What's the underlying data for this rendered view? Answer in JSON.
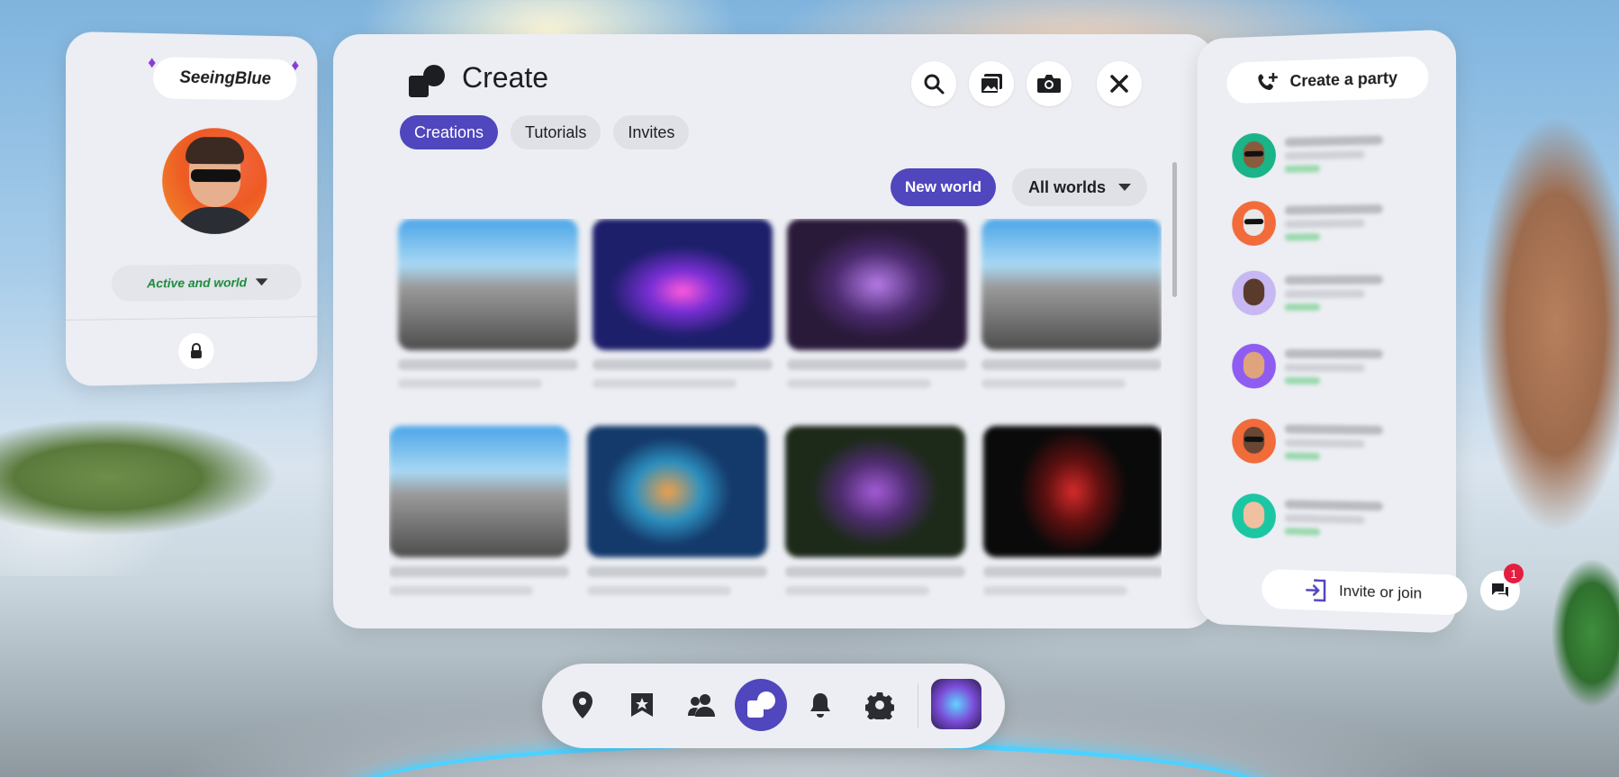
{
  "profile": {
    "username": "SeeingBlue",
    "status_label": "Active and world",
    "gem_glyph": "♦"
  },
  "create": {
    "title": "Create",
    "tabs": [
      {
        "label": "Creations",
        "active": true
      },
      {
        "label": "Tutorials",
        "active": false
      },
      {
        "label": "Invites",
        "active": false
      }
    ],
    "new_world_label": "New world",
    "filter_label": "All worlds",
    "worlds": [
      {
        "thumb": "sky"
      },
      {
        "thumb": "neon"
      },
      {
        "thumb": "find"
      },
      {
        "thumb": "sky"
      },
      {
        "thumb": "sky"
      },
      {
        "thumb": "blue"
      },
      {
        "thumb": "purple"
      },
      {
        "thumb": "spin"
      }
    ]
  },
  "party": {
    "create_party_label": "Create a party",
    "invite_join_label": "Invite or join",
    "chat_badge_count": "1",
    "friends": [
      {
        "color": "#1bb388"
      },
      {
        "color": "#f26b3a"
      },
      {
        "color": "#c7b8f4"
      },
      {
        "color": "#8f5cf2"
      },
      {
        "color": "#f26b3a"
      },
      {
        "color": "#1bc7a3"
      }
    ]
  },
  "dock": {
    "items": [
      "location-pin-icon",
      "saved-worlds-icon",
      "people-icon",
      "create-icon",
      "bell-icon",
      "gear-icon"
    ],
    "active_index": 3
  },
  "colors": {
    "accent": "#5046bd",
    "badge": "#e41e3f",
    "online": "#1b8a3a"
  }
}
